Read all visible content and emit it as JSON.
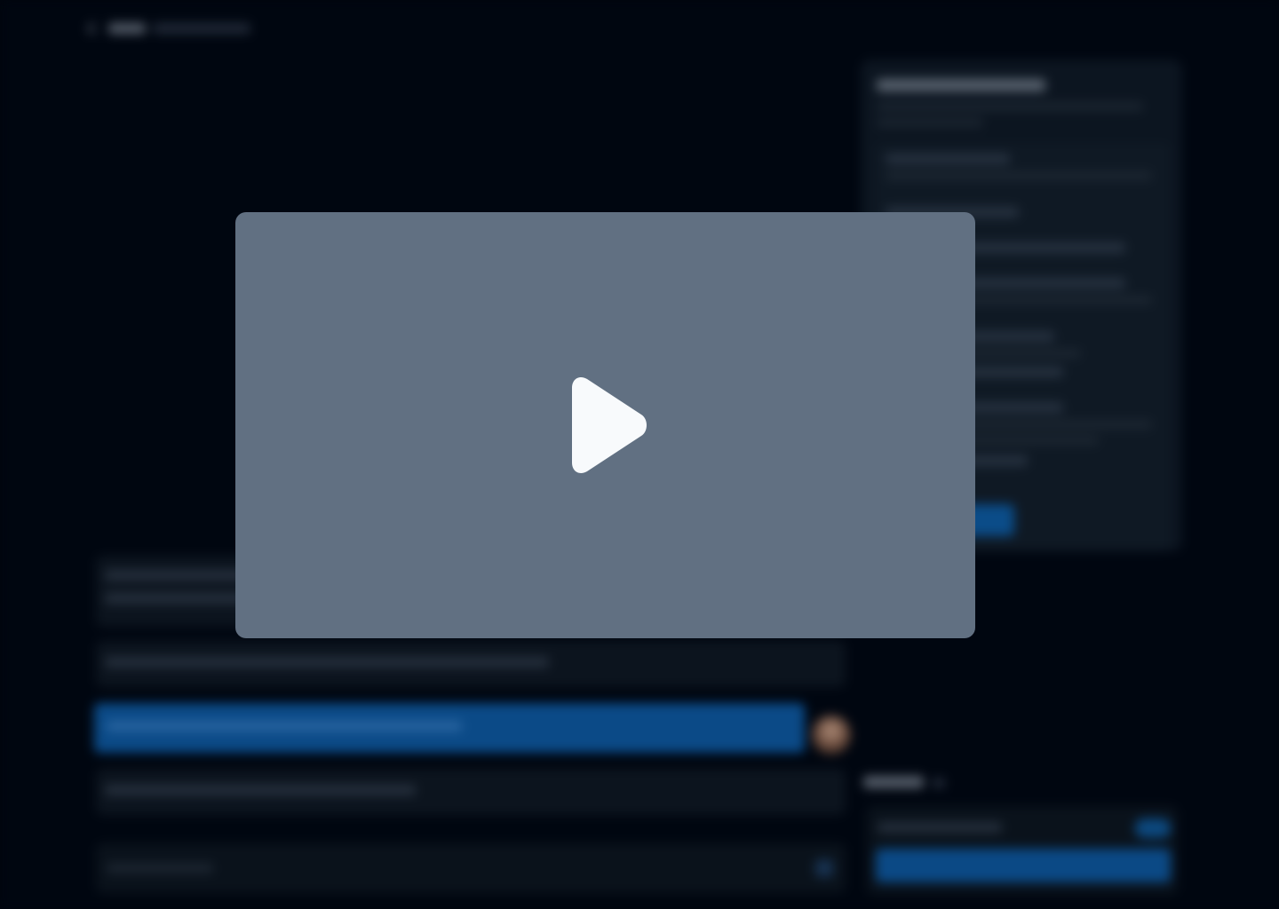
{
  "colors": {
    "page_background": "#00050e",
    "video_placeholder": "#617082",
    "play_icon": "#f8fafc",
    "accent_blue": "#0b4a87"
  },
  "video": {
    "icon": "play-icon"
  }
}
